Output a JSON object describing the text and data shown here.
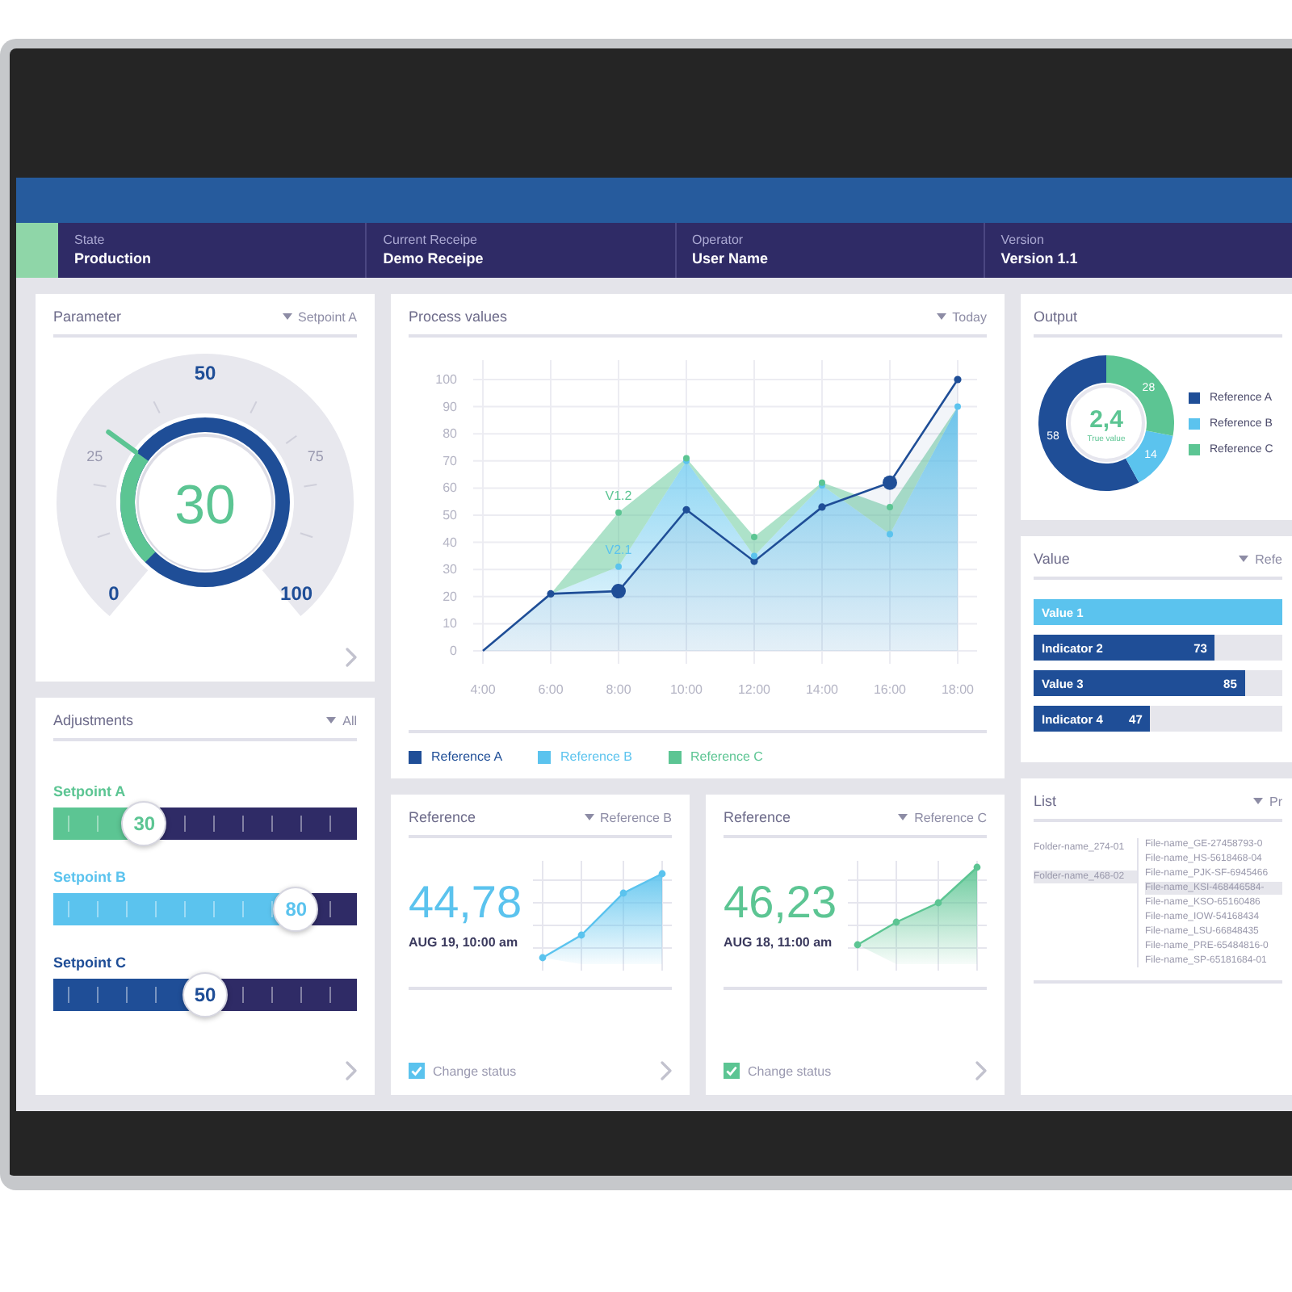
{
  "header": {
    "sections": [
      {
        "label": "State",
        "value": "Production"
      },
      {
        "label": "Current Receipe",
        "value": "Demo Receipe"
      },
      {
        "label": "Operator",
        "value": "User Name"
      },
      {
        "label": "Version",
        "value": "Version 1.1"
      }
    ]
  },
  "parameter": {
    "title": "Parameter",
    "dropdown": "Setpoint A",
    "gauge": {
      "level": 0.3,
      "value": "30",
      "scale": [
        "0",
        "25",
        "50",
        "75",
        "100"
      ]
    }
  },
  "adjustments": {
    "title": "Adjustments",
    "dropdown": "All",
    "sliders": [
      {
        "label": "Setpoint A",
        "value": "30",
        "level": 0.3,
        "color": "#5cc593"
      },
      {
        "label": "Setpoint B",
        "value": "80",
        "level": 0.8,
        "color": "#5bc3ee"
      },
      {
        "label": "Setpoint C",
        "value": "50",
        "level": 0.5,
        "color": "#1f4e97"
      }
    ]
  },
  "process_values": {
    "title": "Process values",
    "dropdown": "Today",
    "chart_data": {
      "type": "area",
      "categories": [
        "4:00",
        "6:00",
        "8:00",
        "10:00",
        "12:00",
        "14:00",
        "16:00",
        "18:00"
      ],
      "series": [
        {
          "name": "Reference A",
          "color": "#1f4e97",
          "values": [
            0,
            21,
            22,
            52,
            33,
            53,
            62,
            100
          ]
        },
        {
          "name": "Reference B",
          "color": "#5bc3ee",
          "values": [
            0,
            21,
            31,
            70,
            35,
            61,
            43,
            90
          ]
        },
        {
          "name": "Reference C",
          "color": "#5cc593",
          "values": [
            null,
            21,
            51,
            71,
            42,
            62,
            53,
            90
          ]
        }
      ],
      "ylim": [
        0,
        100
      ],
      "yticks": [
        0,
        10,
        20,
        30,
        40,
        50,
        60,
        70,
        80,
        90,
        100
      ],
      "grid": true,
      "annotations": [
        {
          "text": "V1.2",
          "x": "8:00",
          "y": 51
        },
        {
          "text": "V2.1",
          "x": "8:00",
          "y": 31
        },
        {
          "x": "8:00"
        },
        {
          "x": "16:00"
        }
      ]
    }
  },
  "references": [
    {
      "title": "Reference",
      "dropdown": "Reference B",
      "value": "44,78",
      "date": "AUG 19, 10:00 am",
      "color": "#5bc3ee",
      "checkbox": {
        "label": "Change status",
        "checked": true
      }
    },
    {
      "title": "Reference",
      "dropdown": "Reference C",
      "value": "46,23",
      "date": "AUG 18, 11:00 am",
      "color": "#5cc593",
      "checkbox": {
        "label": "Change status",
        "checked": true
      }
    }
  ],
  "output": {
    "title": "Output",
    "center_value": "2,4",
    "center_label": "True value",
    "chart_data": {
      "type": "donut",
      "categories": [
        "Reference A",
        "Reference B",
        "Reference C"
      ],
      "values": [
        58,
        14,
        28
      ],
      "colors": [
        "#1f4e97",
        "#5bc3ee",
        "#5cc593"
      ],
      "data_labels": true
    }
  },
  "value_panel": {
    "title": "Value",
    "dropdown": "Refe",
    "bars": [
      {
        "label": "Value 1",
        "selected": true
      },
      {
        "label": "Indicator 2",
        "reading": "73",
        "level": 0.73,
        "selected": false
      },
      {
        "label": "Value 3",
        "reading": "85",
        "level": 0.85,
        "selected": false
      },
      {
        "label": "Indicator 4",
        "reading": "47",
        "level": 0.47,
        "selected": false
      }
    ]
  },
  "list": {
    "title": "List",
    "dropdown": "Pr",
    "folders": [
      {
        "label": "Folder-name_274-01",
        "selected": false
      },
      {
        "label": "Folder-name_468-02",
        "selected": true
      }
    ],
    "files": [
      {
        "label": "File-name_GE-27458793-0",
        "selected": false
      },
      {
        "label": "File-name_HS-5618468-04",
        "selected": false
      },
      {
        "label": "File-name_PJK-SF-6945466",
        "selected": false
      },
      {
        "label": "File-name_KSI-468446584-",
        "selected": true
      },
      {
        "label": "File-name_KSO-65160486",
        "selected": false
      },
      {
        "label": "File-name_IOW-54168434",
        "selected": false
      },
      {
        "label": "File-name_LSU-66848435",
        "selected": false
      },
      {
        "label": "File-name_PRE-65484816-0",
        "selected": false
      },
      {
        "label": "File-name_SP-65181684-01",
        "selected": false
      }
    ]
  }
}
